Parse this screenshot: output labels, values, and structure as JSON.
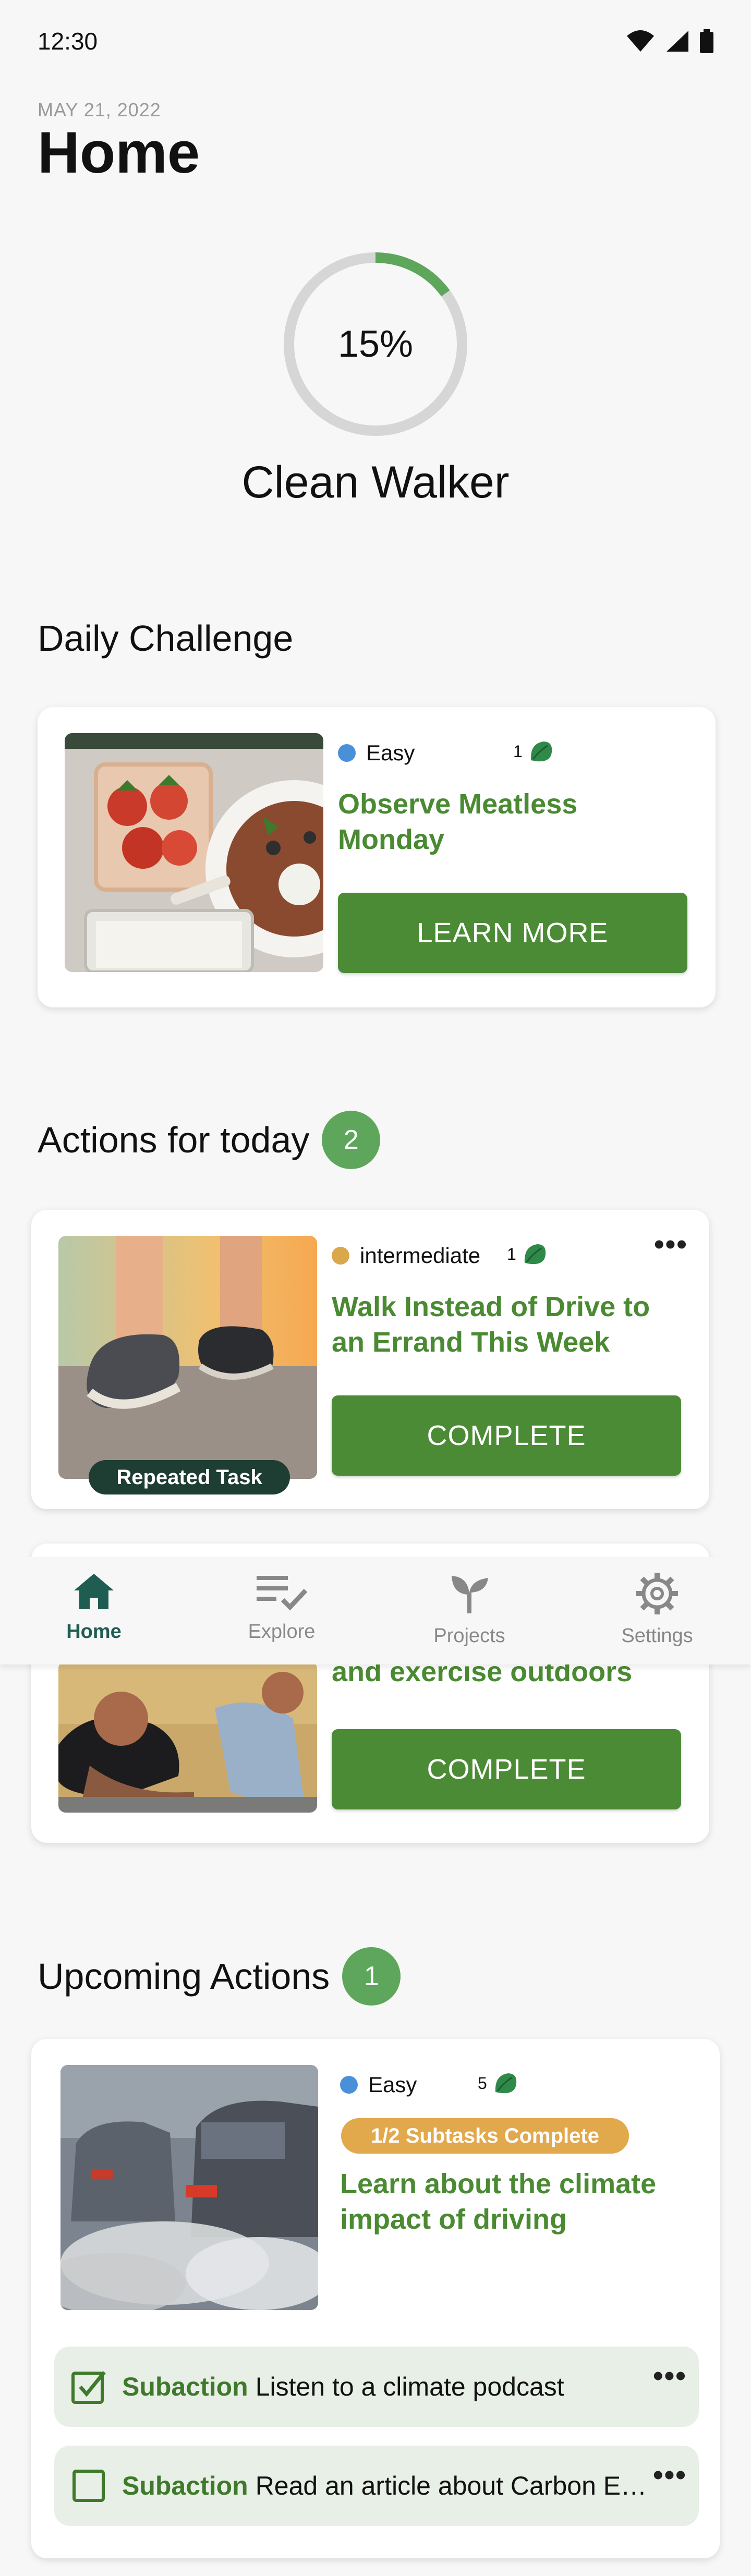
{
  "status_bar": {
    "time": "12:30"
  },
  "header": {
    "date": "MAY 21, 2022",
    "title": "Home"
  },
  "progress": {
    "percent_label": "15%",
    "fraction": 0.15,
    "level_name": "Clean Walker"
  },
  "daily_challenge": {
    "section_title": "Daily Challenge",
    "difficulty": "Easy",
    "difficulty_color": "#4a90d9",
    "points": "1",
    "title": "Observe Meatless Monday",
    "button_label": "LEARN MORE"
  },
  "actions_today": {
    "section_title": "Actions for today",
    "count": "2",
    "items": [
      {
        "difficulty": "intermediate",
        "difficulty_color": "#d9a84a",
        "points": "1",
        "title": "Walk Instead of Drive to an Errand This Week",
        "button_label": "COMPLETE",
        "tag": "Repeated Task",
        "more": "•••"
      },
      {
        "title_partial": "and exercise outdoors",
        "button_label": "COMPLETE"
      }
    ]
  },
  "upcoming": {
    "section_title": "Upcoming Actions",
    "count": "1",
    "item": {
      "difficulty": "Easy",
      "difficulty_color": "#4a90d9",
      "points": "5",
      "subtask_status": "1/2 Subtasks Complete",
      "title": "Learn about the climate impact of driving",
      "subactions": [
        {
          "label": "Subaction",
          "text": "Listen to a climate podcast",
          "checked": true,
          "more": "•••"
        },
        {
          "label": "Subaction",
          "text": "Read an article about Carbon E…",
          "checked": false,
          "more": "•••"
        }
      ]
    }
  },
  "nav": {
    "items": [
      {
        "label": "Home",
        "icon": "home-icon",
        "active": true
      },
      {
        "label": "Explore",
        "icon": "explore-icon",
        "active": false
      },
      {
        "label": "Projects",
        "icon": "sprout-icon",
        "active": false
      },
      {
        "label": "Settings",
        "icon": "gear-icon",
        "active": false
      }
    ]
  },
  "colors": {
    "accent_green": "#4c8b35",
    "title_green": "#4a8a32",
    "badge_green": "#5ea65b",
    "nav_active": "#1f5c52"
  }
}
